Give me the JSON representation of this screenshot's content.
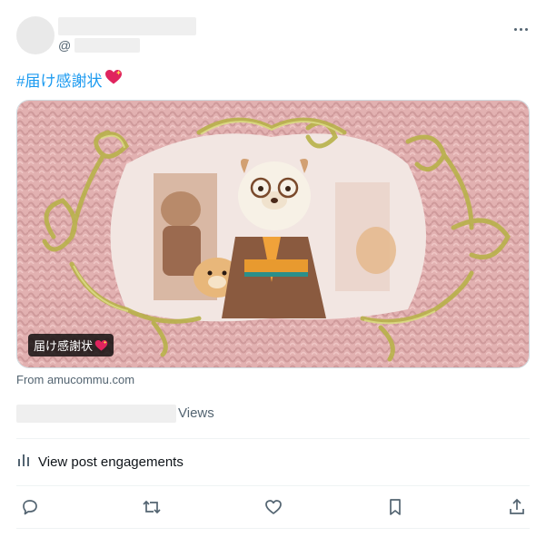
{
  "post": {
    "handle_prefix": "@",
    "hashtag": "#届け感謝状",
    "hashtag_emoji": "💖",
    "media_tag": "届け感謝状",
    "source": "From amucommu.com",
    "views_label": "Views",
    "engagements_label": "View post engagements"
  },
  "icons": {
    "more": "more-icon",
    "engagements": "bar-chart-icon",
    "reply": "reply-icon",
    "repost": "repost-icon",
    "like": "heart-icon",
    "bookmark": "bookmark-icon",
    "share": "share-icon"
  },
  "colors": {
    "link": "#1d9bf0",
    "muted": "#536471",
    "text": "#0f1419"
  }
}
